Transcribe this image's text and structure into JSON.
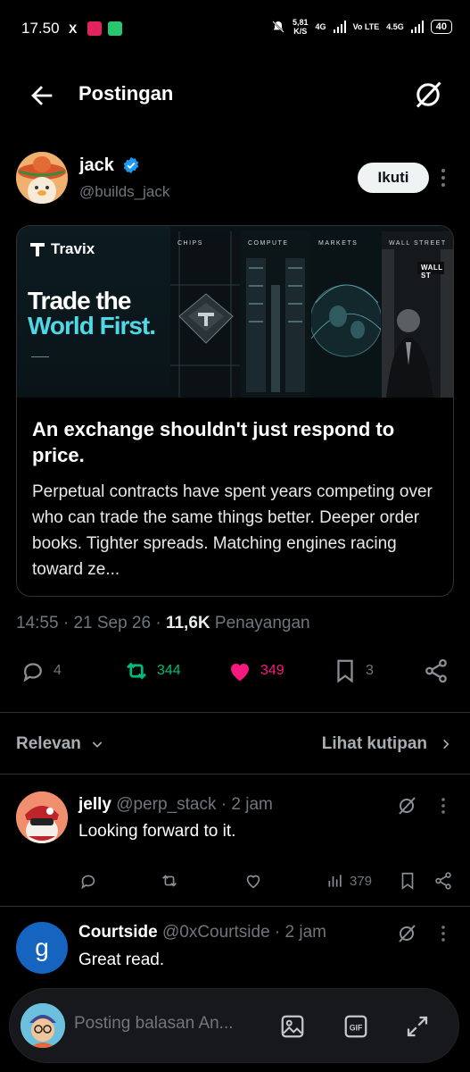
{
  "status_bar": {
    "time": "17.50",
    "x_icon": "X",
    "net_speed_value": "5,81",
    "net_speed_unit": "K/S",
    "net1": "4G",
    "volte": "Vo LTE",
    "net2": "4.5G",
    "battery": "40"
  },
  "header": {
    "title": "Postingan"
  },
  "author": {
    "name": "jack",
    "handle": "@builds_jack",
    "follow_label": "Ikuti"
  },
  "banner": {
    "brand": "Travix",
    "tagline_line1": "Trade the",
    "tagline_line2": "World First.",
    "panels": [
      "CHIPS",
      "COMPUTE",
      "MARKETS",
      "WALL STREET"
    ],
    "sign": "WALL ST"
  },
  "article": {
    "title": "An exchange shouldn't just respond to price.",
    "body": "Perpetual contracts have spent years competing over who can trade the same things better. Deeper order books. Tighter spreads. Matching engines racing toward ze..."
  },
  "meta": {
    "time": "14:55",
    "sep": "·",
    "date": "21 Sep 26",
    "views": "11,6K",
    "views_label": "Penayangan"
  },
  "actions": {
    "replies": "4",
    "reposts": "344",
    "likes": "349",
    "bookmarks": "3"
  },
  "sort": {
    "relevance_label": "Relevan",
    "quotes_label": "Lihat kutipan"
  },
  "replies": [
    {
      "name": "jelly",
      "handle": "@perp_stack",
      "time": "· 2 jam",
      "text": "Looking forward to it.",
      "views": "379"
    },
    {
      "name": "Courtside",
      "handle": "@0xCourtside",
      "time": "· 2 jam",
      "text": "Great read.",
      "avatar_letter": "g"
    }
  ],
  "composer": {
    "placeholder": "Posting balasan An..."
  },
  "colors": {
    "accent": "#1d9bf0",
    "repost": "#00ba7c",
    "like": "#f91880",
    "border": "#2f3336",
    "muted": "#71767b"
  }
}
